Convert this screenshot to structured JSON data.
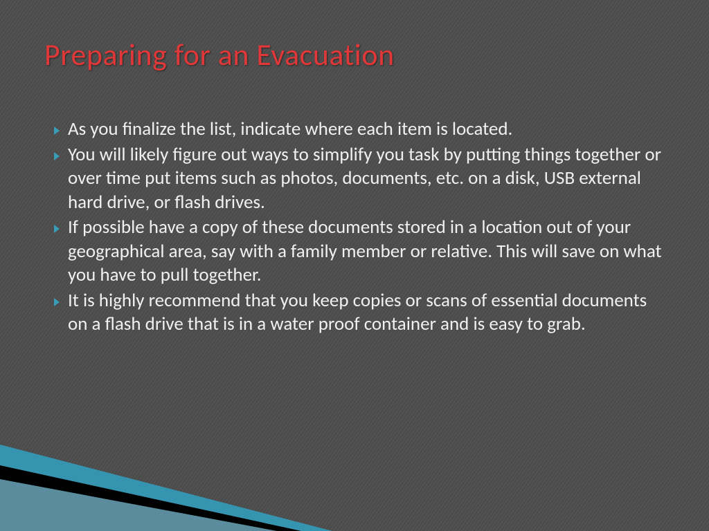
{
  "title": "Preparing for an Evacuation",
  "bullets": [
    "As you finalize the list, indicate where each item is located.",
    "You will likely figure out ways to simplify you task by putting things together or over time put items such as photos, documents, etc. on a disk, USB external hard drive, or flash drives.",
    "If possible have a copy of these documents stored in a location out of your geographical area, say with a family member or relative. This will save on what you have to pull together.",
    "It is highly recommend that you keep copies or scans of essential documents on a flash drive that is in a water proof container and is easy to grab."
  ],
  "colors": {
    "title": "#e03838",
    "text": "#f0f0f0",
    "bullet": "#3a9db8",
    "background": "#4a4a4a"
  }
}
